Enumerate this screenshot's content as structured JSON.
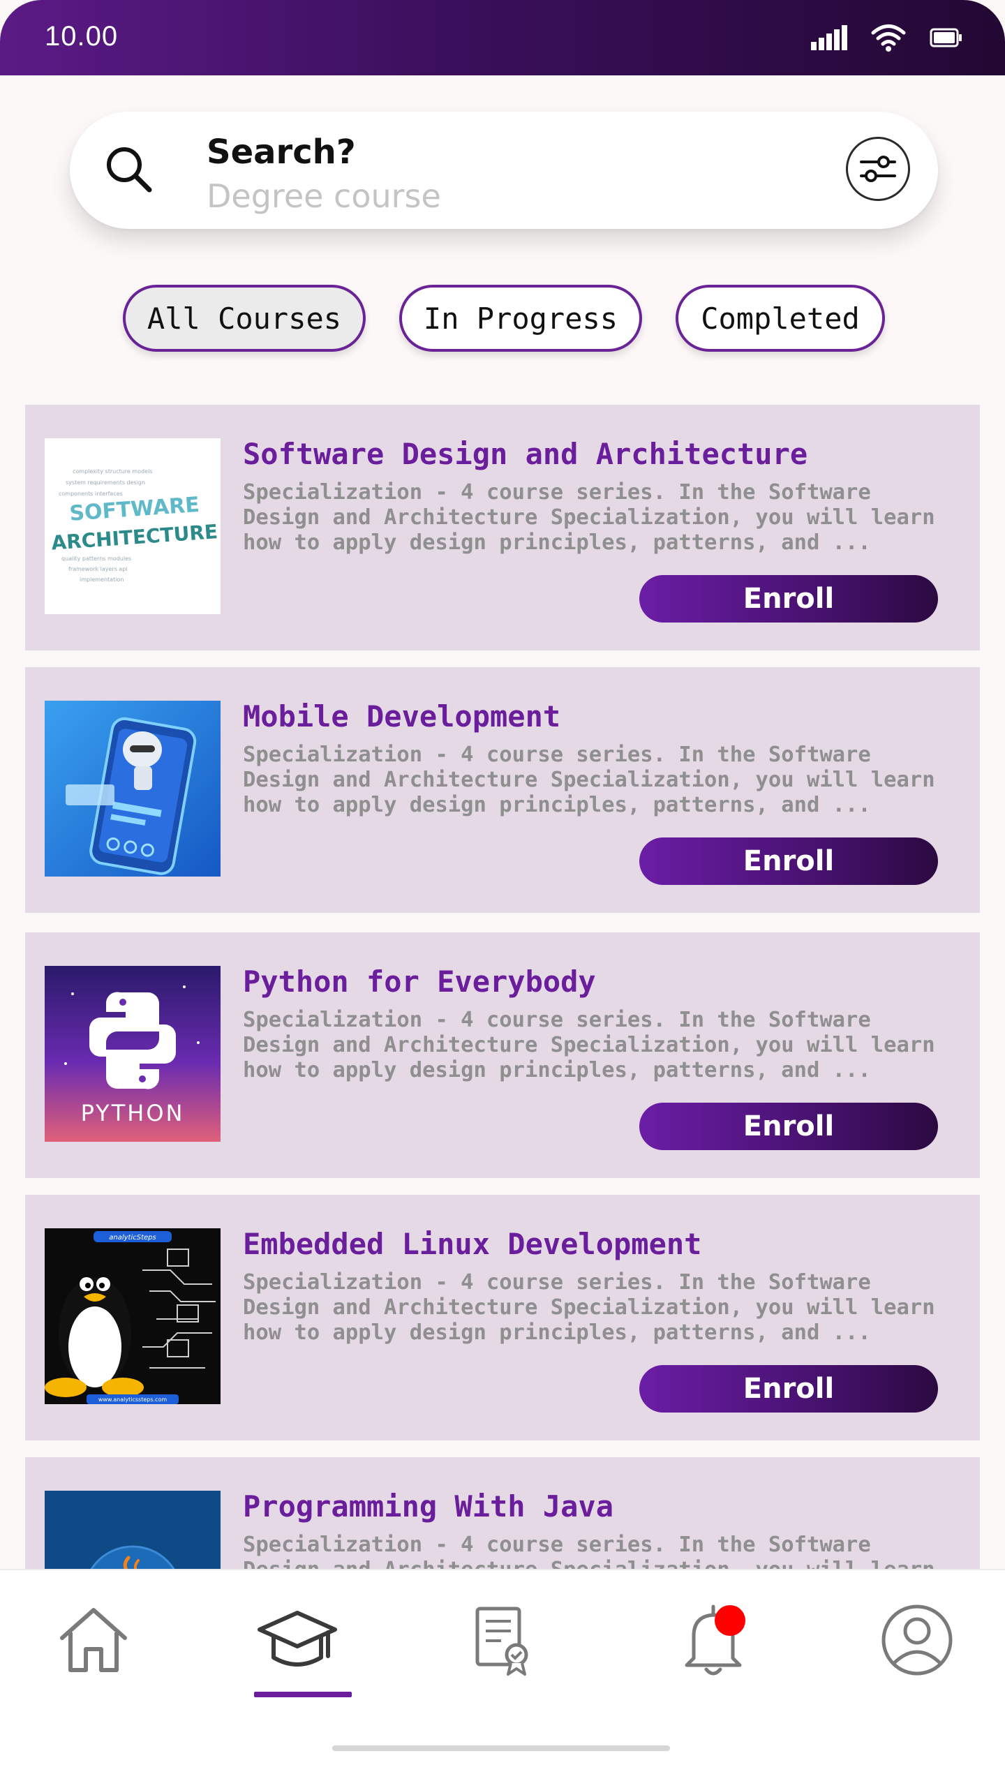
{
  "status_bar": {
    "time": "10.00"
  },
  "search": {
    "title": "Search?",
    "placeholder": "Degree course"
  },
  "tabs": [
    {
      "label": "All Courses",
      "active": true
    },
    {
      "label": "In Progress",
      "active": false
    },
    {
      "label": "Completed",
      "active": false
    }
  ],
  "courses": [
    {
      "title": "Software Design and Architecture",
      "description": "Specialization - 4 course series. In the Software Design and Architecture Specialization, you will learn how to apply design principles, patterns, and ...",
      "button": "Enroll",
      "thumb_text": "SOFTWARE ARCHITECTURE"
    },
    {
      "title": "Mobile Development",
      "description": "Specialization - 4 course series. In the Software Design and Architecture Specialization, you will learn how to apply design principles, patterns, and ...",
      "button": "Enroll"
    },
    {
      "title": "Python for Everybody",
      "description": "Specialization - 4 course series. In the Software Design and Architecture Specialization, you will learn how to apply design principles, patterns, and ...",
      "button": "Enroll",
      "thumb_text": "PYTHON"
    },
    {
      "title": "Embedded Linux Development",
      "description": "Specialization - 4 course series. In the Software Design and Architecture Specialization, you will learn how to apply design principles, patterns, and ...",
      "button": "Enroll",
      "thumb_text": "analyticSteps",
      "thumb_subtext": "www.analyticssteps.com"
    },
    {
      "title": "Programming With Java",
      "description": "Specialization - 4 course series. In the Software Design and Architecture Specialization, you will learn"
    }
  ],
  "bottom_nav": [
    {
      "icon": "home-icon",
      "active": false
    },
    {
      "icon": "graduation-cap-icon",
      "active": true
    },
    {
      "icon": "certificate-icon",
      "active": false
    },
    {
      "icon": "bell-icon",
      "active": false,
      "badge": true
    },
    {
      "icon": "profile-icon",
      "active": false
    }
  ],
  "colors": {
    "accent": "#6a1e9c",
    "card_bg": "#e5d9e6",
    "status_bar": "#3a0f5c",
    "badge": "#ff0000"
  }
}
